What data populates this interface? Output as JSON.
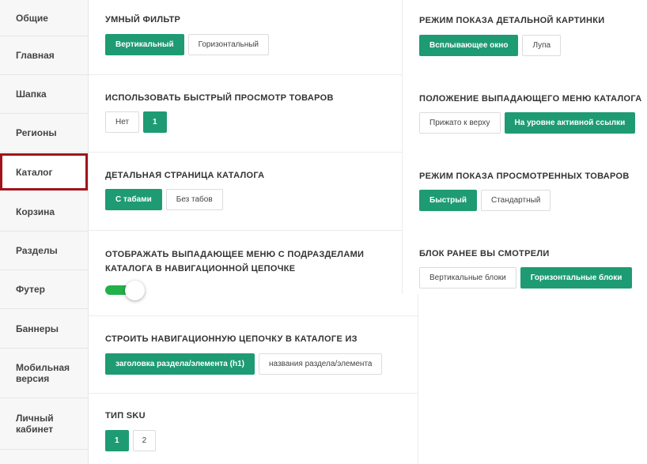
{
  "sidebar": {
    "items": [
      {
        "label": "Общие"
      },
      {
        "label": "Главная"
      },
      {
        "label": "Шапка"
      },
      {
        "label": "Регионы"
      },
      {
        "label": "Каталог"
      },
      {
        "label": "Корзина"
      },
      {
        "label": "Разделы"
      },
      {
        "label": "Футер"
      },
      {
        "label": "Баннеры"
      },
      {
        "label": "Мобильная версия"
      },
      {
        "label": "Личный кабинет"
      }
    ],
    "active_index": 4
  },
  "left": {
    "smart_filter": {
      "title": "УМНЫЙ ФИЛЬТР",
      "options": [
        "Вертикальный",
        "Горизонтальный"
      ],
      "selected": "Вертикальный"
    },
    "quick_view": {
      "title": "ИСПОЛЬЗОВАТЬ БЫСТРЫЙ ПРОСМОТР ТОВАРОВ",
      "options": [
        "Нет",
        "1"
      ],
      "selected": "1"
    },
    "catalog_detail": {
      "title": "ДЕТАЛЬНАЯ СТРАНИЦА КАТАЛОГА",
      "options": [
        "С табами",
        "Без табов"
      ],
      "selected": "С табами"
    },
    "breadcrumb_menu": {
      "title": "ОТОБРАЖАТЬ ВЫПАДАЮЩЕЕ МЕНЮ С ПОДРАЗДЕЛАМИ КАТАЛОГА В НАВИГАЦИОННОЙ ЦЕПОЧКЕ",
      "enabled": true
    },
    "breadcrumb_source": {
      "title": "СТРОИТЬ НАВИГАЦИОННУЮ ЦЕПОЧКУ В КАТАЛОГЕ ИЗ",
      "options": [
        "заголовка раздела/элемента (h1)",
        "названия раздела/элемента"
      ],
      "selected": "заголовка раздела/элемента (h1)"
    },
    "sku_type": {
      "title": "ТИП SKU",
      "options": [
        "1",
        "2"
      ],
      "selected": "1"
    }
  },
  "right": {
    "detail_picture": {
      "title": "РЕЖИМ ПОКАЗА ДЕТАЛЬНОЙ КАРТИНКИ",
      "options": [
        "Всплывающее окно",
        "Лупа"
      ],
      "selected": "Всплывающее окно"
    },
    "dropdown_position": {
      "title": "ПОЛОЖЕНИЕ ВЫПАДАЮЩЕГО МЕНЮ КАТАЛОГА",
      "options": [
        "Прижато к верху",
        "На уровне активной ссылки"
      ],
      "selected": "На уровне активной ссылки"
    },
    "viewed_mode": {
      "title": "РЕЖИМ ПОКАЗА ПРОСМОТРЕННЫХ ТОВАРОВ",
      "options": [
        "Быстрый",
        "Стандартный"
      ],
      "selected": "Быстрый"
    },
    "viewed_block": {
      "title": "БЛОК РАНЕЕ ВЫ СМОТРЕЛИ",
      "options": [
        "Вертикальные блоки",
        "Горизонтальные блоки"
      ],
      "selected": "Горизонтальные блоки"
    }
  },
  "colors": {
    "accent": "#1e9b73",
    "toggle_on": "#22b04b",
    "active_border": "#a3131b"
  }
}
